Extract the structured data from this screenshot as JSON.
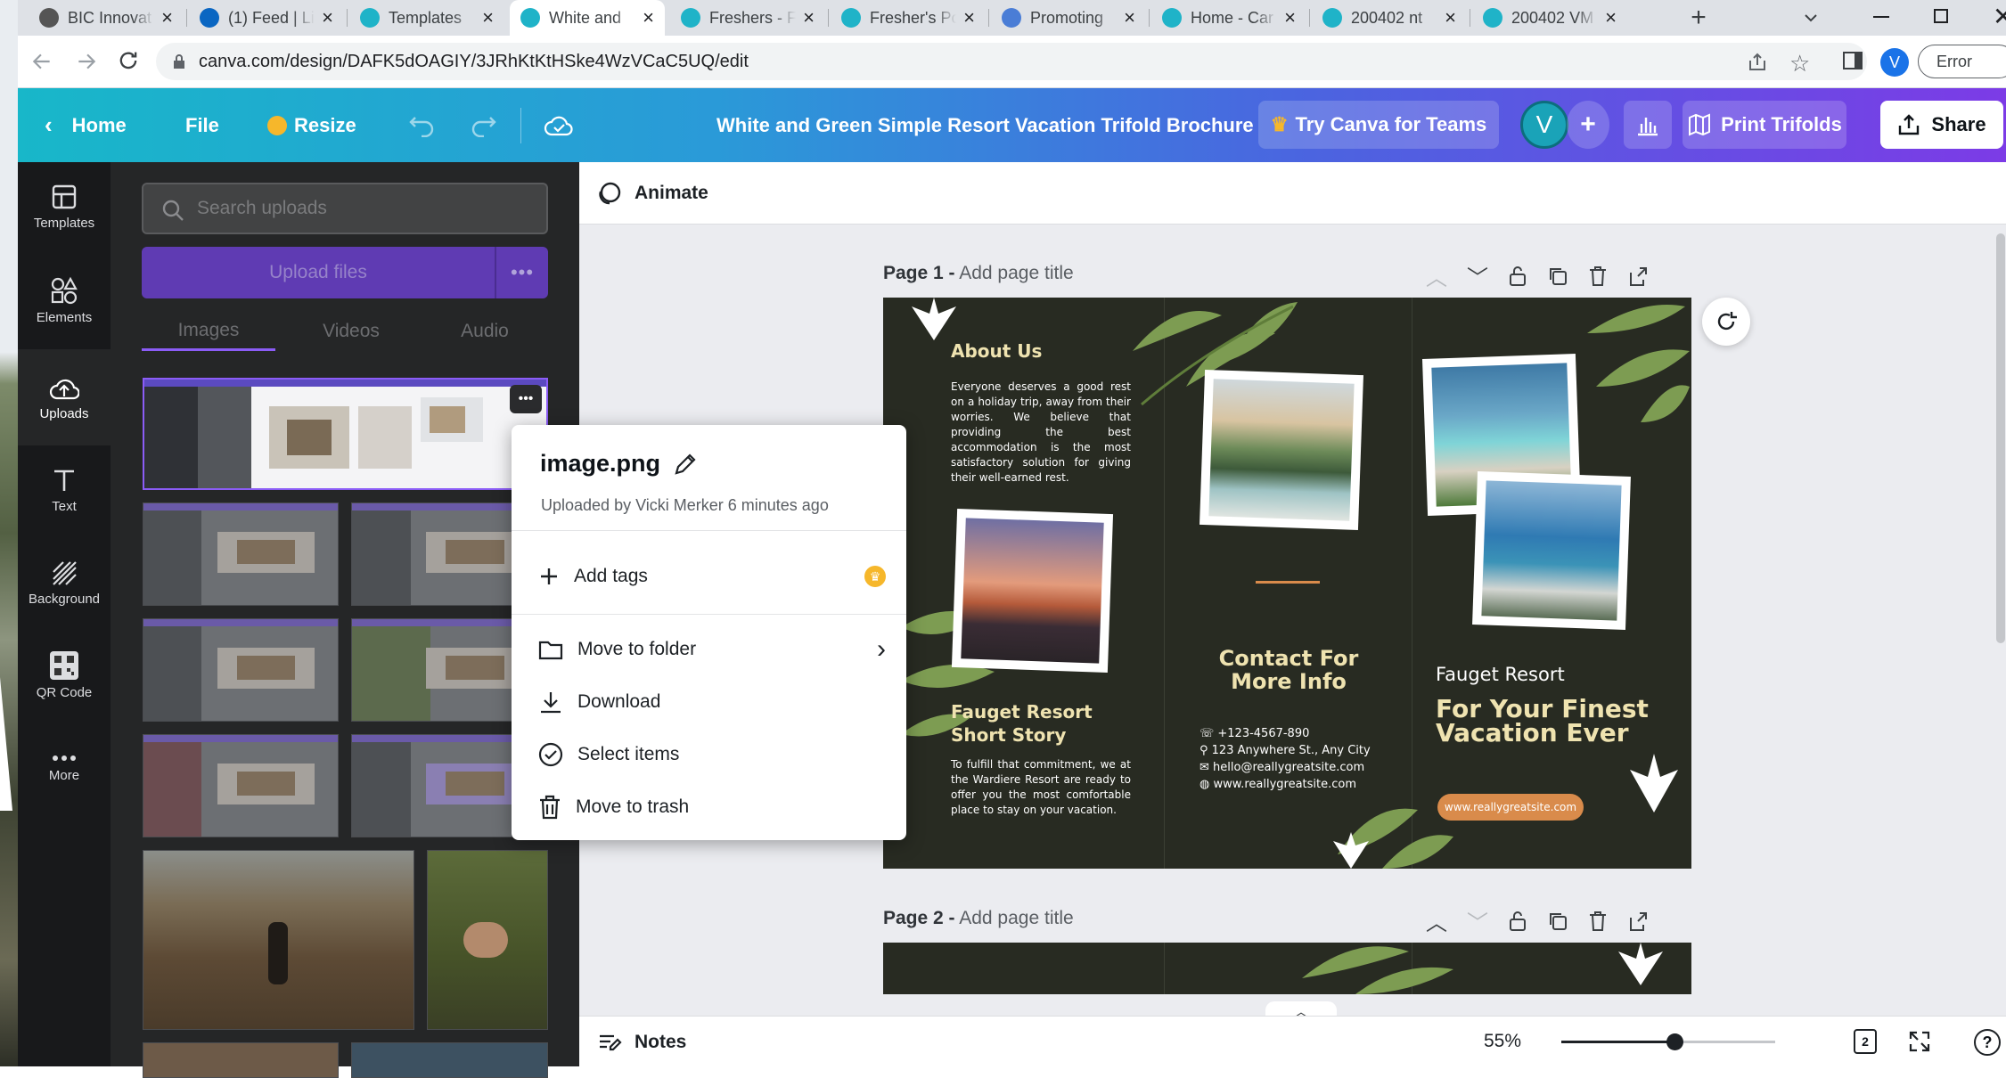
{
  "browser": {
    "tabs": [
      {
        "title": "BIC Innovat",
        "fav": "#555"
      },
      {
        "title": "(1) Feed | Li",
        "fav": "#0a66c2"
      },
      {
        "title": "Templates",
        "fav": "#1fb3c8"
      },
      {
        "title": "White and",
        "fav": "#1fb3c8"
      },
      {
        "title": "Freshers - F",
        "fav": "#1fb3c8"
      },
      {
        "title": "Fresher's Po",
        "fav": "#1fb3c8"
      },
      {
        "title": "Promoting",
        "fav": "#4a7dd6"
      },
      {
        "title": "Home - Car",
        "fav": "#1fb3c8"
      },
      {
        "title": "200402 nt",
        "fav": "#1fb3c8"
      },
      {
        "title": "200402 VM",
        "fav": "#1fb3c8"
      }
    ],
    "url": "canva.com/design/DAFK5dOAGIY/3JRhKtKtHSke4WzVCaC5UQ/edit",
    "profile_initial": "V",
    "error_label": "Error"
  },
  "header": {
    "home": "Home",
    "file": "File",
    "resize": "Resize",
    "doc_title": "White and Green Simple Resort Vacation Trifold Brochure",
    "try_teams": "Try Canva for Teams",
    "avatar": "V",
    "print": "Print Trifolds",
    "share": "Share"
  },
  "rail": [
    {
      "label": "Templates",
      "icon": "templates-icon"
    },
    {
      "label": "Elements",
      "icon": "elements-icon"
    },
    {
      "label": "Uploads",
      "icon": "uploads-icon"
    },
    {
      "label": "Text",
      "icon": "text-icon"
    },
    {
      "label": "Background",
      "icon": "background-icon"
    },
    {
      "label": "QR Code",
      "icon": "qr-code-icon"
    },
    {
      "label": "More",
      "icon": "more-icon"
    }
  ],
  "panel": {
    "search_placeholder": "Search uploads",
    "upload_label": "Upload files",
    "tabs": [
      "Images",
      "Videos",
      "Audio"
    ]
  },
  "popup": {
    "filename": "image.png",
    "meta": "Uploaded by Vicki Merker 6 minutes ago",
    "add_tags": "Add tags",
    "move_folder": "Move to folder",
    "download": "Download",
    "select": "Select items",
    "trash": "Move to trash"
  },
  "toolbar": {
    "animate": "Animate"
  },
  "pages": {
    "p1_label": "Page 1 -",
    "p1_title": "Add page title",
    "p2_label": "Page 2 -",
    "p2_title": "Add page title"
  },
  "brochure": {
    "about_title": "About Us",
    "about_body": "Everyone deserves a good rest on a holiday trip, away from their worries. We believe that providing the best accommodation is the most satisfactory solution for giving their well-earned rest.",
    "story_title": "Fauget Resort Short Story",
    "story_body": "To fulfill that commitment, we at the Wardiere Resort are ready to offer you the most comfortable place to stay on your vacation.",
    "contact_title": "Contact For More Info",
    "phone": "+123-4567-890",
    "address": "123 Anywhere St., Any City",
    "email": "hello@reallygreatsite.com",
    "web": "www.reallygreatsite.com",
    "resort_name": "Fauget Resort",
    "tagline": "For Your Finest Vacation Ever",
    "site_button": "www.reallygreatsite.com"
  },
  "footer": {
    "notes": "Notes",
    "zoom": "55%",
    "page_count": "2",
    "zoom_level": 0.55
  },
  "colors": {
    "accent": "#8d43e6",
    "brochure_bg": "#282b22",
    "leaf": "#7a9a4c",
    "orange": "#d98b4b"
  }
}
